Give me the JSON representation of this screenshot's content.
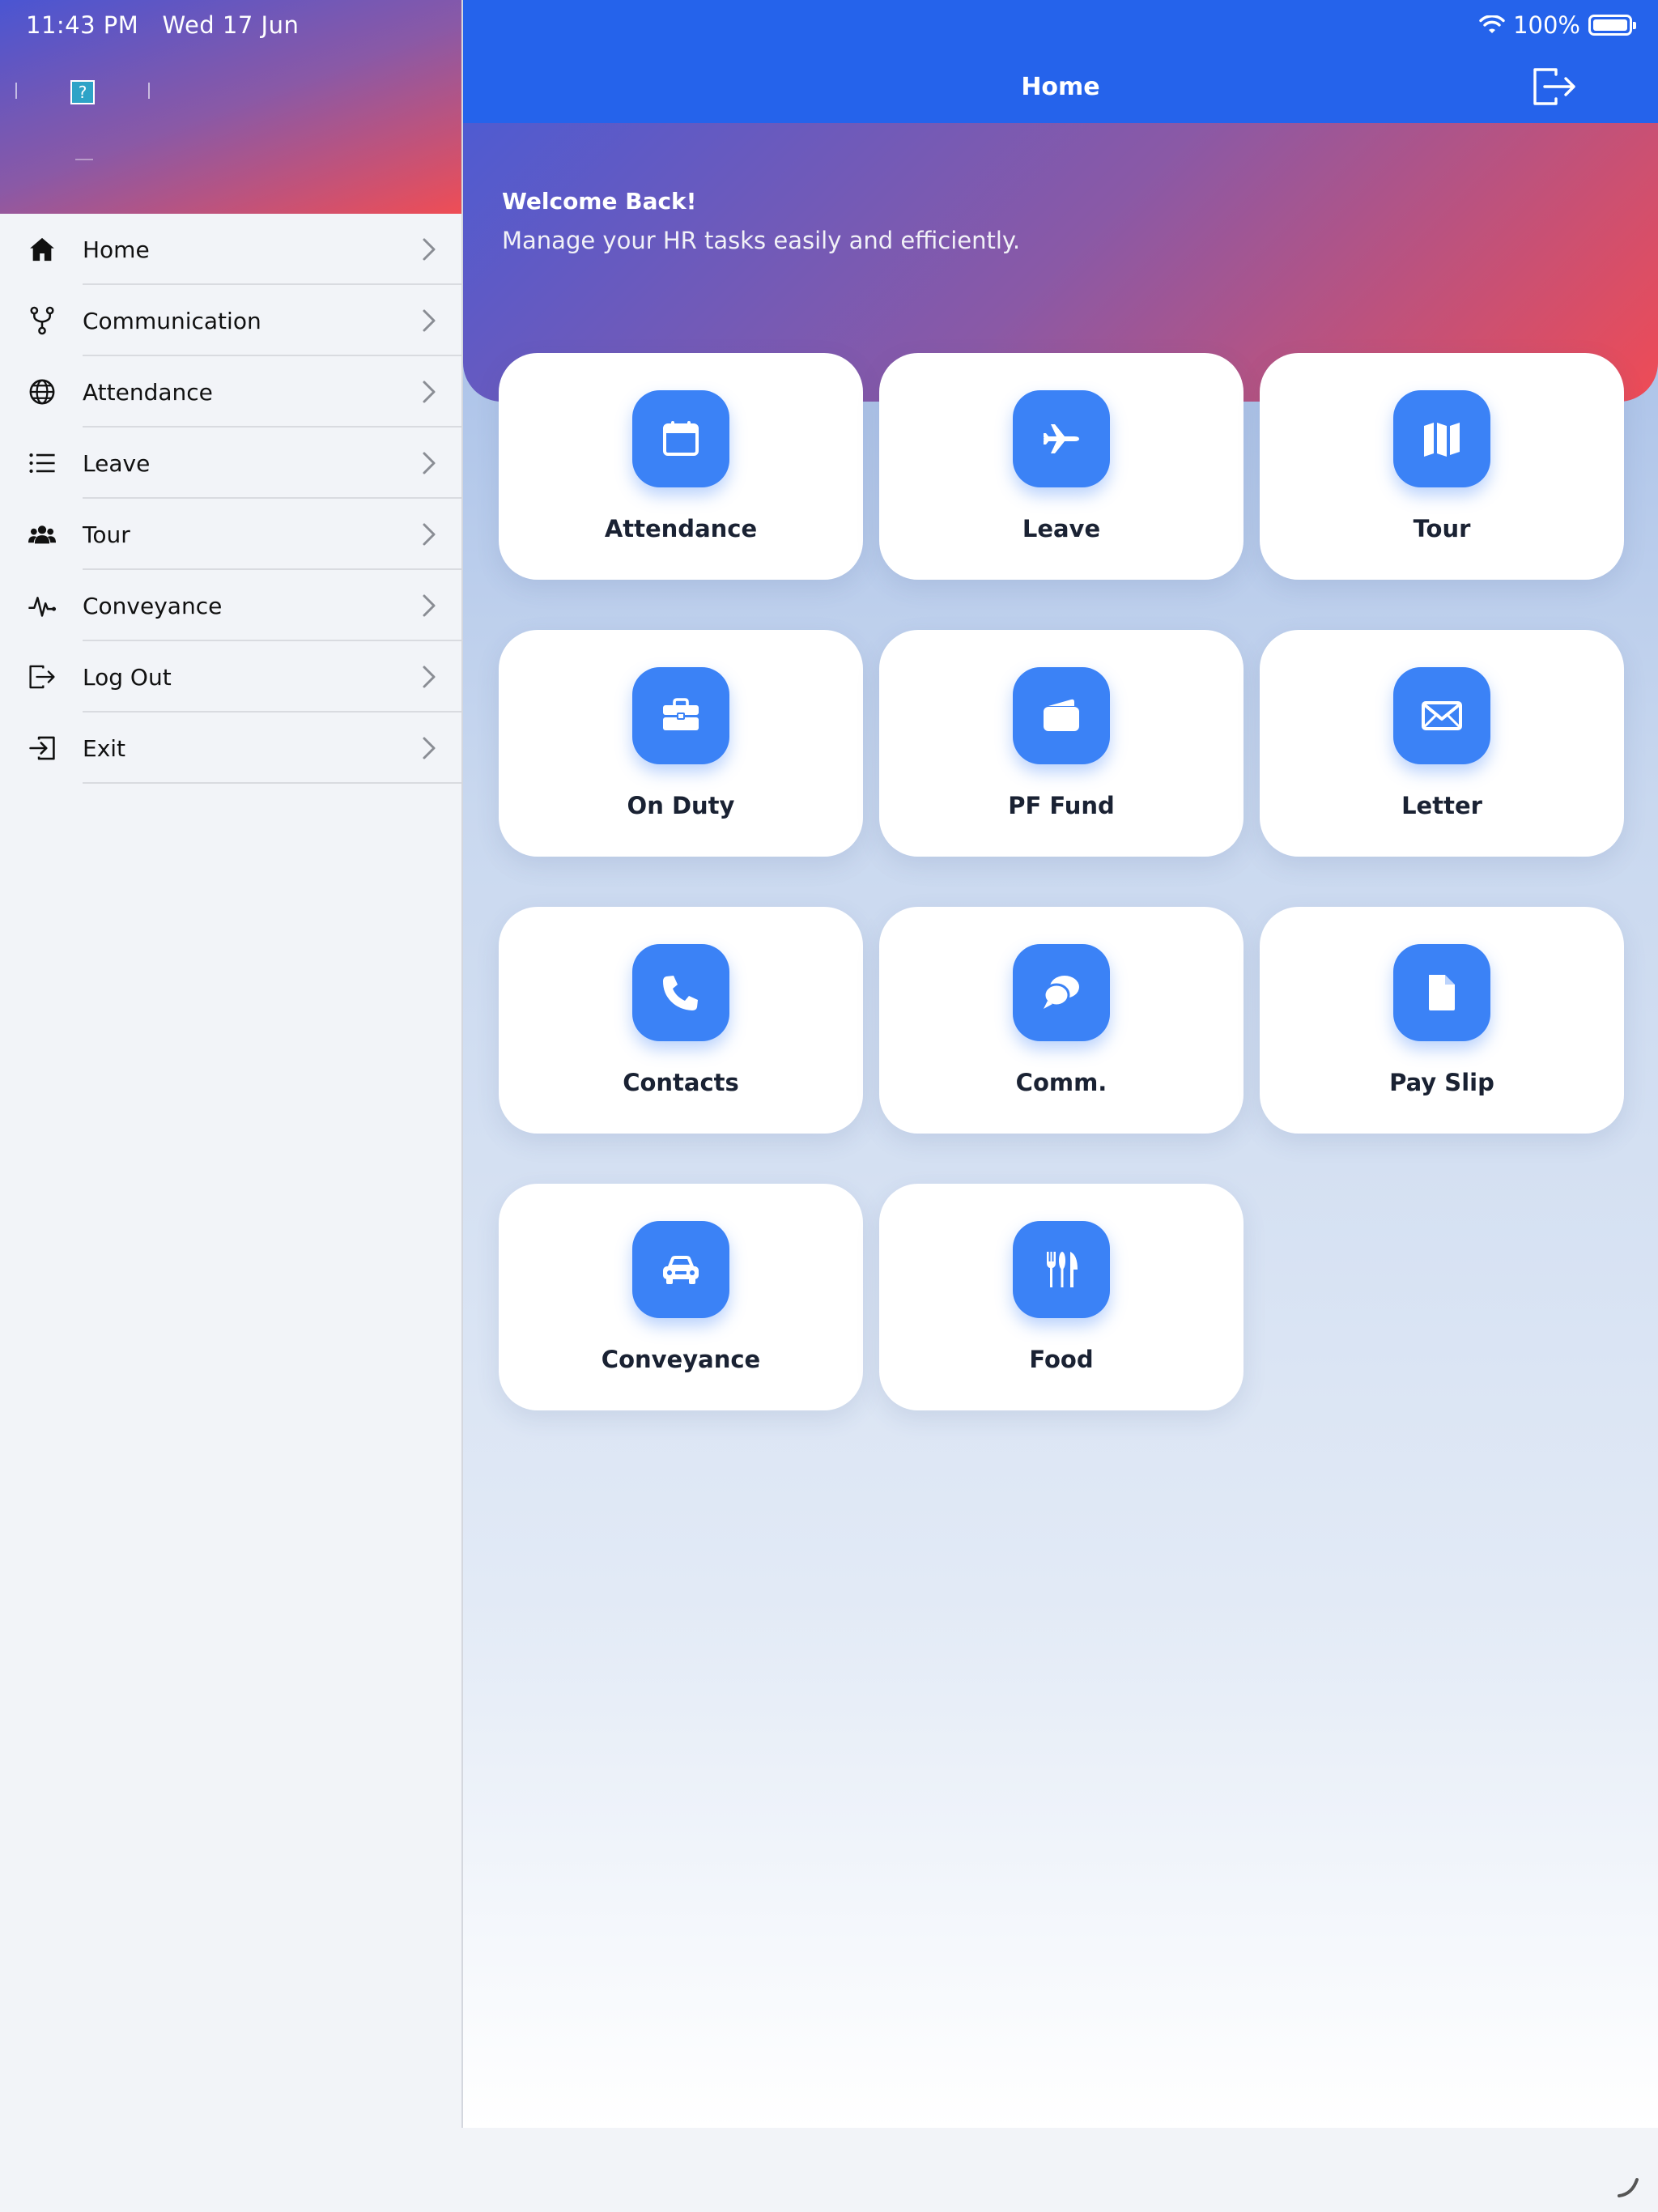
{
  "status_bar": {
    "time": "11:43 PM",
    "date": "Wed 17 Jun",
    "battery": "100%"
  },
  "sidebar": {
    "help_badge": "?",
    "items": [
      {
        "label": "Home",
        "icon": "home-icon"
      },
      {
        "label": "Communication",
        "icon": "branch-icon"
      },
      {
        "label": "Attendance",
        "icon": "globe-icon"
      },
      {
        "label": "Leave",
        "icon": "list-icon"
      },
      {
        "label": "Tour",
        "icon": "users-icon"
      },
      {
        "label": "Conveyance",
        "icon": "pulse-icon"
      },
      {
        "label": "Log Out",
        "icon": "logout-icon"
      },
      {
        "label": "Exit",
        "icon": "exit-icon"
      }
    ]
  },
  "header": {
    "title": "Home"
  },
  "hero": {
    "title": "Welcome Back!",
    "subtitle": "Manage your HR tasks easily and efficiently."
  },
  "tiles": [
    {
      "label": "Attendance",
      "icon": "calendar-icon"
    },
    {
      "label": "Leave",
      "icon": "plane-icon"
    },
    {
      "label": "Tour",
      "icon": "map-icon"
    },
    {
      "label": "On Duty",
      "icon": "briefcase-icon"
    },
    {
      "label": "PF Fund",
      "icon": "wallet-icon"
    },
    {
      "label": "Letter",
      "icon": "envelope-icon"
    },
    {
      "label": "Contacts",
      "icon": "phone-icon"
    },
    {
      "label": "Comm.",
      "icon": "chat-icon"
    },
    {
      "label": "Pay Slip",
      "icon": "file-icon"
    },
    {
      "label": "Conveyance",
      "icon": "car-icon"
    },
    {
      "label": "Food",
      "icon": "utensils-icon"
    }
  ],
  "colors": {
    "accent": "#2563eb",
    "tile_icon_bg": "#3b82f6",
    "gradient_start": "#4f5bd1",
    "gradient_end": "#ef4b55"
  }
}
